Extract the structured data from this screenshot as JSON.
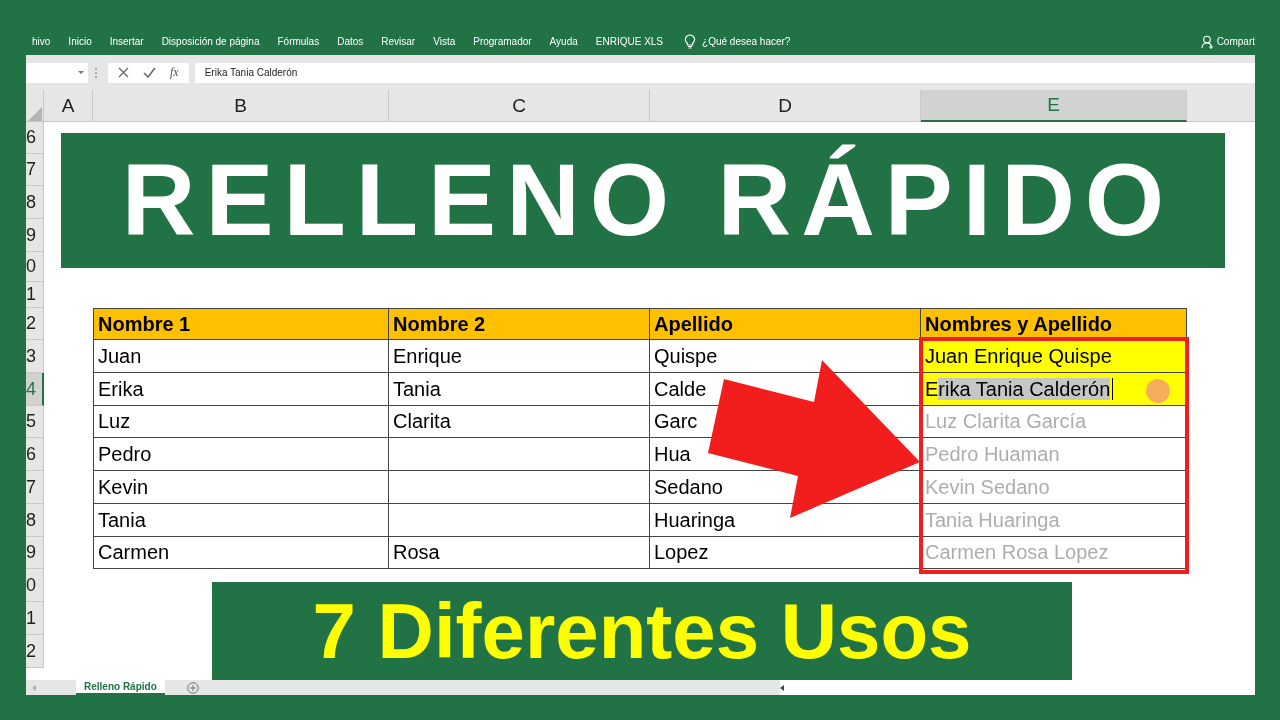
{
  "ribbon": {
    "tabs": [
      {
        "label": "hivo"
      },
      {
        "label": "Inicio"
      },
      {
        "label": "Insertar"
      },
      {
        "label": "Disposición de página"
      },
      {
        "label": "Fórmulas"
      },
      {
        "label": "Datos"
      },
      {
        "label": "Revisar"
      },
      {
        "label": "Vista"
      },
      {
        "label": "Programador"
      },
      {
        "label": "Ayuda"
      },
      {
        "label": "ENRIQUE XLS"
      }
    ],
    "tell_me": "¿Qué desea hacer?",
    "share": "Compart"
  },
  "formula_bar": {
    "function_label": "fx",
    "value": "Erika Tania Calderón"
  },
  "columns": [
    {
      "label": "A",
      "selected": false
    },
    {
      "label": "B",
      "selected": false
    },
    {
      "label": "C",
      "selected": false
    },
    {
      "label": "D",
      "selected": false
    },
    {
      "label": "E",
      "selected": true
    }
  ],
  "rows": [
    {
      "label": "6",
      "selected": false
    },
    {
      "label": "7",
      "selected": false
    },
    {
      "label": "8",
      "selected": false
    },
    {
      "label": "9",
      "selected": false
    },
    {
      "label": "0",
      "selected": false
    },
    {
      "label": "1",
      "selected": false
    },
    {
      "label": "2",
      "selected": false
    },
    {
      "label": "3",
      "selected": false
    },
    {
      "label": "4",
      "selected": true
    },
    {
      "label": "5",
      "selected": false
    },
    {
      "label": "6",
      "selected": false
    },
    {
      "label": "7",
      "selected": false
    },
    {
      "label": "8",
      "selected": false
    },
    {
      "label": "9",
      "selected": false
    },
    {
      "label": "0",
      "selected": false
    },
    {
      "label": "1",
      "selected": false
    },
    {
      "label": "2",
      "selected": false
    }
  ],
  "table": {
    "columns": [
      "Nombre 1",
      "Nombre 2",
      "Apellido",
      "Nombres y Apellido"
    ],
    "rows": [
      {
        "cells": [
          "Juan",
          "Enrique",
          "Quispe"
        ],
        "result": {
          "text": "Juan Enrique Quispe",
          "kind": "value"
        }
      },
      {
        "cells": [
          "Erika",
          "Tania",
          "Calde"
        ],
        "result": {
          "text": "Erika Tania Calderón",
          "kind": "editing"
        }
      },
      {
        "cells": [
          "Luz",
          "Clarita",
          "Garc"
        ],
        "result": {
          "text": "Luz Clarita García",
          "kind": "suggestion"
        }
      },
      {
        "cells": [
          "Pedro",
          null,
          "Hua"
        ],
        "result": {
          "text": "Pedro  Huaman",
          "kind": "suggestion"
        }
      },
      {
        "cells": [
          "Kevin",
          null,
          "Sedano"
        ],
        "result": {
          "text": "Kevin  Sedano",
          "kind": "suggestion"
        }
      },
      {
        "cells": [
          "Tania",
          null,
          "Huaringa"
        ],
        "result": {
          "text": "Tania  Huaringa",
          "kind": "suggestion"
        }
      },
      {
        "cells": [
          "Carmen",
          "Rosa",
          "Lopez"
        ],
        "result": {
          "text": "Carmen Rosa Lopez",
          "kind": "suggestion"
        }
      }
    ]
  },
  "banners": [
    {
      "text": "RELLENO RÁPIDO",
      "kind": "title"
    },
    {
      "text": "7 Diferentes Usos",
      "kind": "subtitle"
    }
  ],
  "sheet_tabs": [
    {
      "label": "Relleno Rápido",
      "selected": true
    }
  ]
}
